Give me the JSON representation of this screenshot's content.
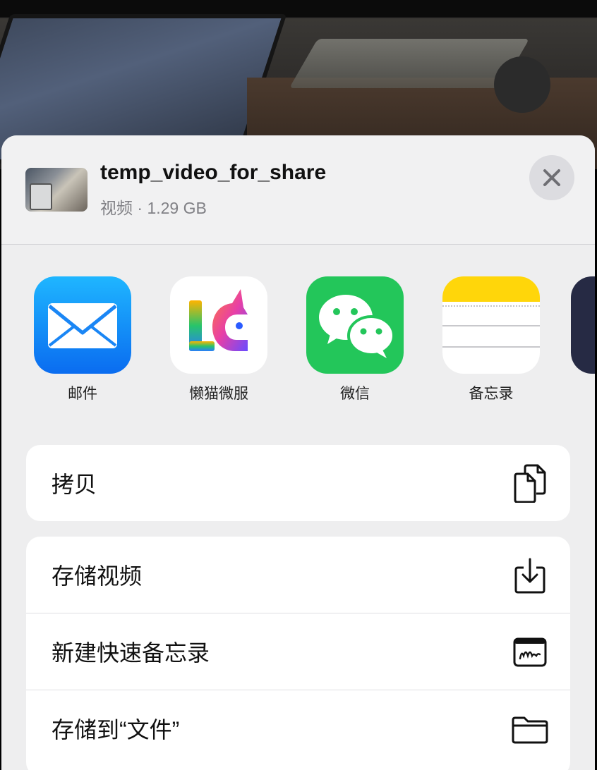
{
  "header": {
    "file_title": "temp_video_for_share",
    "file_meta": "视频 · 1.29 GB"
  },
  "apps": [
    {
      "label": "邮件",
      "icon": "mail-icon"
    },
    {
      "label": "懒猫微服",
      "icon": "lanmao-icon"
    },
    {
      "label": "微信",
      "icon": "wechat-icon"
    },
    {
      "label": "备忘录",
      "icon": "notes-icon"
    }
  ],
  "actions_primary": [
    {
      "label": "拷贝",
      "icon": "copy-icon"
    }
  ],
  "actions_secondary": [
    {
      "label": "存储视频",
      "icon": "download-icon"
    },
    {
      "label": "新建快速备忘录",
      "icon": "quick-note-icon"
    },
    {
      "label": "存储到“文件”",
      "icon": "folder-icon"
    }
  ],
  "colors": {
    "sheet_bg": "#eeeeef",
    "mail_blue": "#0a6cf0",
    "wechat_green": "#23c65a",
    "notes_yellow": "#ffd60a"
  }
}
